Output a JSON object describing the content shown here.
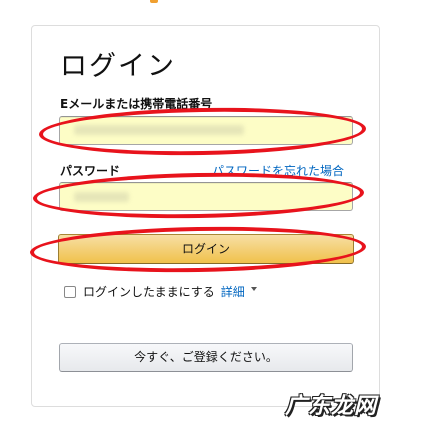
{
  "login_form": {
    "title": "ログイン",
    "email_label": "Eメールまたは携帯電話番号",
    "email_value": "",
    "password_label": "パスワード",
    "password_value": "",
    "forgot_password_link": "パスワードを忘れた場合",
    "submit_label": "ログイン",
    "remember_label": "ログインしたままにする",
    "remember_checked": false,
    "details_link": "詳細",
    "register_label": "今すぐ、ご登録ください。"
  },
  "watermark": {
    "text": "广东龙网"
  },
  "colors": {
    "link": "#0066c0",
    "input_background": "#fdfdc6",
    "primary_button": "#f0c14b",
    "annotation_red": "#e8131c"
  }
}
